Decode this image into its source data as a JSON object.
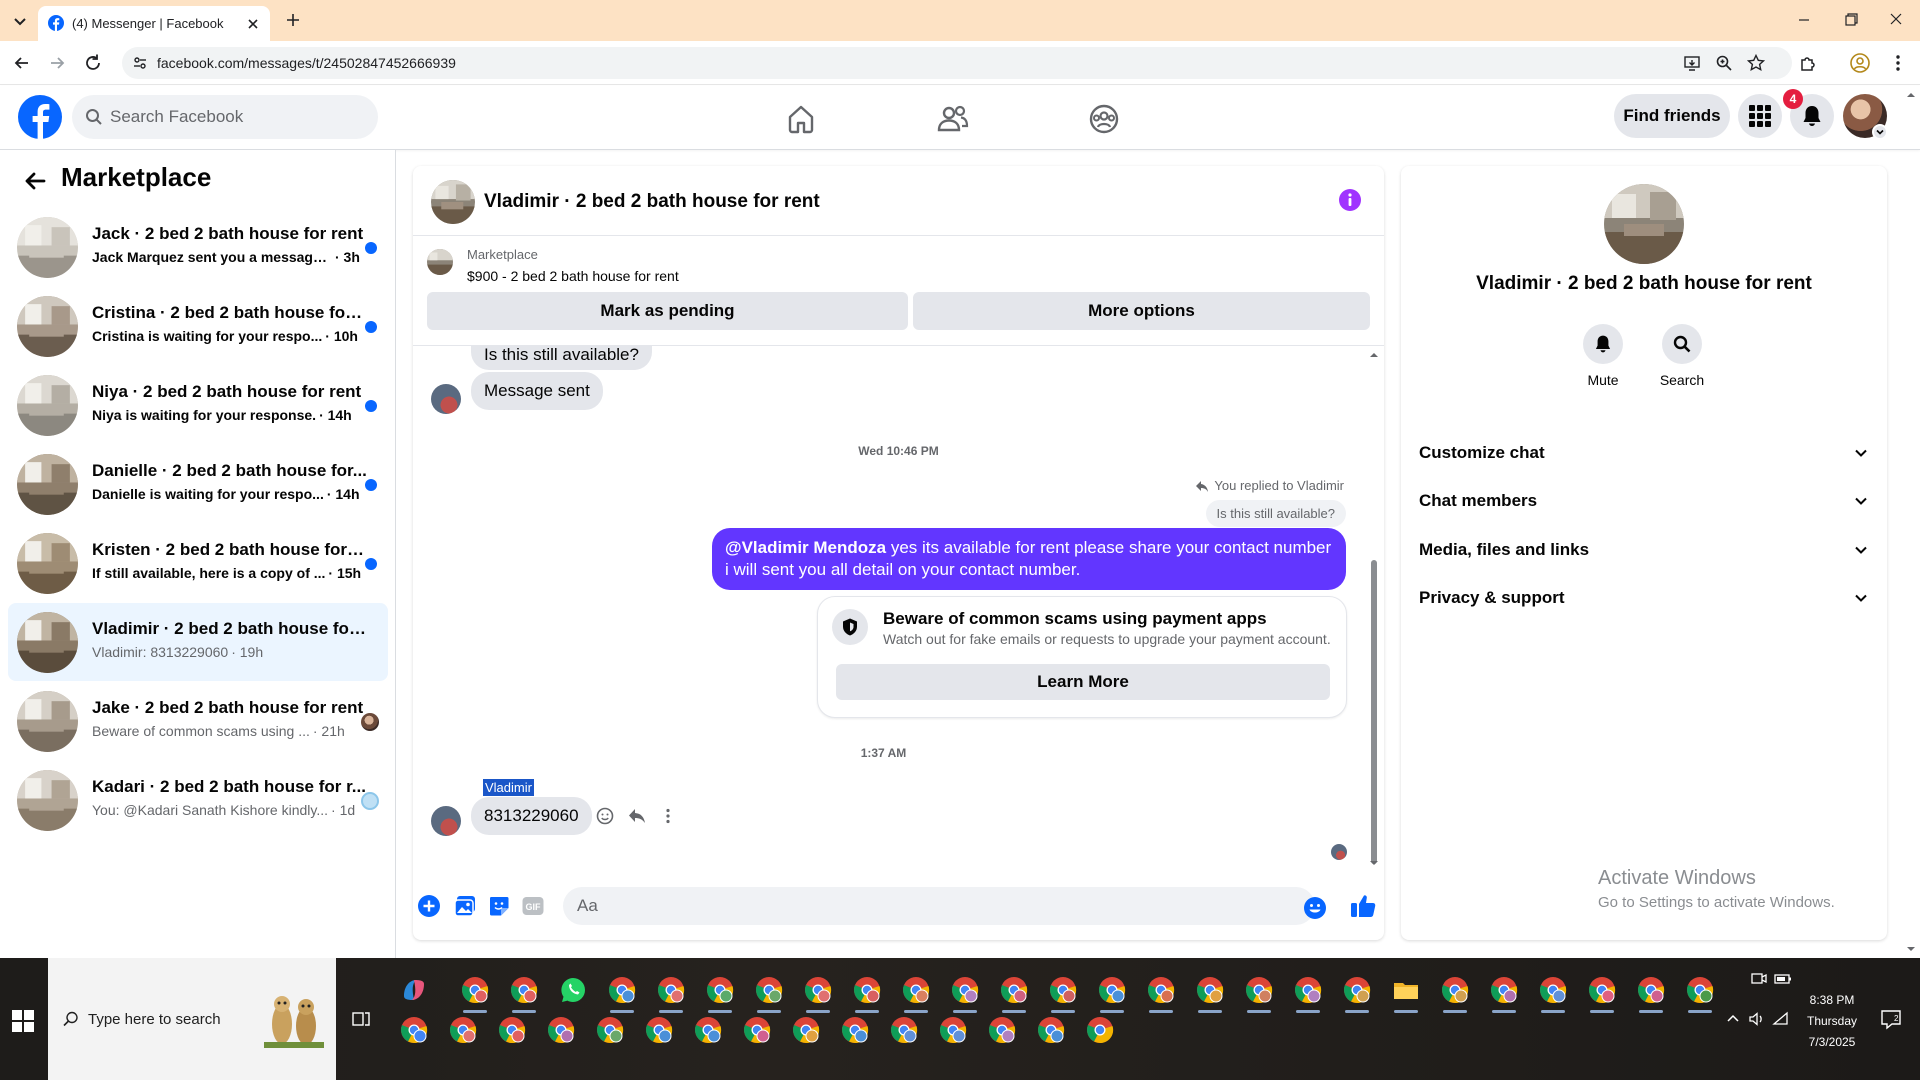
{
  "browser": {
    "tab_title": "(4) Messenger | Facebook",
    "url": "facebook.com/messages/t/24502847452666939"
  },
  "fb_nav": {
    "search_placeholder": "Search Facebook",
    "find_friends_label": "Find friends",
    "notification_count": "4"
  },
  "sidebar": {
    "title": "Marketplace",
    "conversations": [
      {
        "name": "Jack · 2 bed 2 bath house for rent",
        "preview": "Jack Marquez sent you a message ...",
        "time": "· 3h",
        "unread": true
      },
      {
        "name": "Cristina · 2 bed 2 bath house for ...",
        "preview": "Cristina is waiting for your respo...",
        "time": "· 10h",
        "unread": true
      },
      {
        "name": "Niya · 2 bed 2 bath house for rent",
        "preview": "Niya is waiting for your response.",
        "time": "· 14h",
        "unread": true
      },
      {
        "name": "Danielle · 2 bed 2 bath house for...",
        "preview": "Danielle is waiting for your respo...",
        "time": "· 14h",
        "unread": true
      },
      {
        "name": "Kristen · 2 bed 2 bath house for r...",
        "preview": "If still available, here is a copy of ...",
        "time": "· 15h",
        "unread": true
      },
      {
        "name": "Vladimir · 2 bed 2 bath house for r...",
        "preview": "Vladimir: 8313229060",
        "time": "· 19h",
        "unread": false
      },
      {
        "name": "Jake · 2 bed 2 bath house for rent",
        "preview": "Beware of common scams using ...",
        "time": "· 21h",
        "unread": false
      },
      {
        "name": "Kadari · 2 bed 2 bath house for r...",
        "preview": "You: @Kadari Sanath Kishore kindly...",
        "time": "· 1d",
        "unread": false
      }
    ]
  },
  "chat": {
    "title": "Vladimir · 2 bed 2 bath house for rent",
    "marketplace_label": "Marketplace",
    "listing": "$900 - 2 bed 2 bath house for rent",
    "mark_pending_label": "Mark as pending",
    "more_options_label": "More options",
    "messages": {
      "partial_in": "Is this still available?",
      "sent_in": "Message sent",
      "timestamp_1": "Wed 10:46 PM",
      "replied_to": "You replied to Vladimir",
      "quoted": "Is this still available?",
      "out_mention": "@Vladimir Mendoza",
      "out_text": " yes its available for rent please share your contact number i will sent you all detail on your contact number.",
      "scam_title": "Beware of common scams using payment apps",
      "scam_sub": "Watch out for fake emails or requests to upgrade your payment account.",
      "learn_more": "Learn More",
      "timestamp_2": "1:37 AM",
      "sender": "Vladimir",
      "last_in": "8313229060"
    },
    "composer_placeholder": "Aa"
  },
  "info_panel": {
    "name": "Vladimir · 2 bed 2 bath house for rent",
    "mute_label": "Mute",
    "search_label": "Search",
    "sections": [
      "Customize chat",
      "Chat members",
      "Media, files and links",
      "Privacy & support"
    ]
  },
  "watermark": {
    "line1": "Activate Windows",
    "line2": "Go to Settings to activate Windows."
  },
  "taskbar": {
    "search_placeholder": "Type here to search",
    "time": "8:38 PM",
    "day": "Thursday",
    "date": "7/3/2025"
  },
  "colors": {
    "fb_blue": "#0866ff",
    "outgoing_bubble": "#6236ff",
    "info_purple": "#a033ff",
    "badge_red": "#e41e3f",
    "tabbar_peach": "#fde2c4"
  }
}
